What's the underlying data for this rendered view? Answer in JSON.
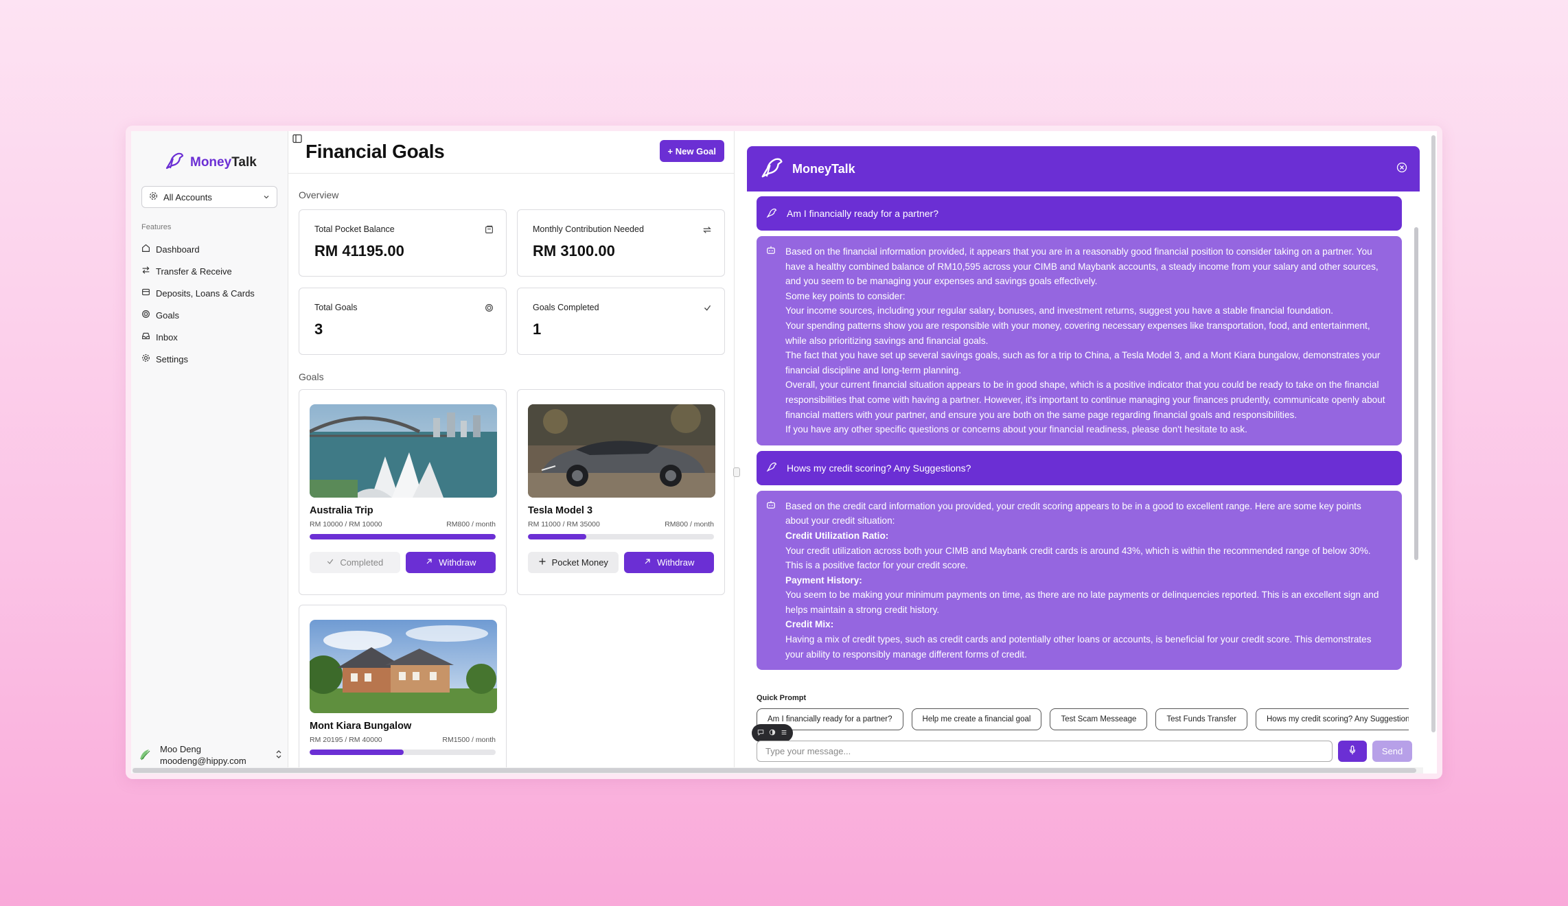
{
  "brand": {
    "name_prefix": "Money",
    "name_suffix": "Talk"
  },
  "sidebar": {
    "account_select": "All Accounts",
    "features_label": "Features",
    "items": [
      {
        "label": "Dashboard",
        "icon": "home-icon"
      },
      {
        "label": "Transfer & Receive",
        "icon": "transfer-icon"
      },
      {
        "label": "Deposits, Loans & Cards",
        "icon": "card-icon"
      },
      {
        "label": "Goals",
        "icon": "target-icon"
      },
      {
        "label": "Inbox",
        "icon": "inbox-icon"
      },
      {
        "label": "Settings",
        "icon": "gear-icon"
      }
    ],
    "user": {
      "name": "Moo Deng",
      "email": "moodeng@hippy.com"
    }
  },
  "main": {
    "title": "Financial Goals",
    "new_goal_label": "+ New Goal",
    "overview_label": "Overview",
    "goals_label": "Goals",
    "stats": [
      {
        "title": "Total Pocket Balance",
        "value": "RM 41195.00",
        "icon": "wallet-icon"
      },
      {
        "title": "Monthly Contribution Needed",
        "value": "RM 3100.00",
        "icon": "repeat-icon"
      },
      {
        "title": "Total Goals",
        "value": "3",
        "icon": "target-icon"
      },
      {
        "title": "Goals Completed",
        "value": "1",
        "icon": "check-icon"
      }
    ],
    "goals": [
      {
        "name": "Australia Trip",
        "amount": "RM 10000 / RM 10000",
        "monthly": "RM800 / month",
        "progress": 1.0,
        "action1": "Completed",
        "action2": "Withdraw"
      },
      {
        "name": "Tesla Model 3",
        "amount": "RM 11000 / RM 35000",
        "monthly": "RM800 / month",
        "progress": 0.314,
        "action1": "Pocket Money",
        "action2": "Withdraw"
      },
      {
        "name": "Mont Kiara Bungalow",
        "amount": "RM 20195 / RM 40000",
        "monthly": "RM1500 / month",
        "progress": 0.505
      }
    ]
  },
  "chat": {
    "title": "MoneyTalk",
    "messages": [
      {
        "role": "user",
        "text": "Am I financially ready for a partner?"
      },
      {
        "role": "bot",
        "lines": [
          "Based on the financial information provided, it appears that you are in a reasonably good financial position to consider taking on a partner. You have a healthy combined balance of RM10,595 across your CIMB and Maybank accounts, a steady income from your salary and other sources, and you seem to be managing your expenses and savings goals effectively.",
          "Some key points to consider:",
          "Your income sources, including your regular salary, bonuses, and investment returns, suggest you have a stable financial foundation.",
          "Your spending patterns show you are responsible with your money, covering necessary expenses like transportation, food, and entertainment, while also prioritizing savings and financial goals.",
          "The fact that you have set up several savings goals, such as for a trip to China, a Tesla Model 3, and a Mont Kiara bungalow, demonstrates your financial discipline and long-term planning.",
          "Overall, your current financial situation appears to be in good shape, which is a positive indicator that you could be ready to take on the financial responsibilities that come with having a partner. However, it's important to continue managing your finances prudently, communicate openly about financial matters with your partner, and ensure you are both on the same page regarding financial goals and responsibilities.",
          "If you have any other specific questions or concerns about your financial readiness, please don't hesitate to ask."
        ]
      },
      {
        "role": "user",
        "text": "Hows my credit scoring? Any Suggestions?"
      },
      {
        "role": "bot",
        "lines": [
          "Based on the credit card information you provided, your credit scoring appears to be in a good to excellent range. Here are some key points about your credit situation:",
          "Credit Utilization Ratio:",
          "Your credit utilization across both your CIMB and Maybank credit cards is around 43%, which is within the recommended range of below 30%. This is a positive factor for your credit score.",
          "Payment History:",
          "You seem to be making your minimum payments on time, as there are no late payments or delinquencies reported. This is an excellent sign and helps maintain a strong credit history.",
          "Credit Mix:",
          "Having a mix of credit types, such as credit cards and potentially other loans or accounts, is beneficial for your credit score. This demonstrates your ability to responsibly manage different forms of credit."
        ]
      }
    ],
    "quick_prompt_label": "Quick Prompt",
    "quick_prompts": [
      "Am I financially ready for a partner?",
      "Help me create a financial goal",
      "Test Scam Messeage",
      "Test Funds Transfer",
      "Hows my credit scoring? Any Suggestions?"
    ],
    "input_placeholder": "Type your message...",
    "send_label": "Send"
  },
  "colors": {
    "accent": "#6b2fd4",
    "bot_bubble": "#9566e0",
    "send_disabled": "#b7a0e8"
  }
}
